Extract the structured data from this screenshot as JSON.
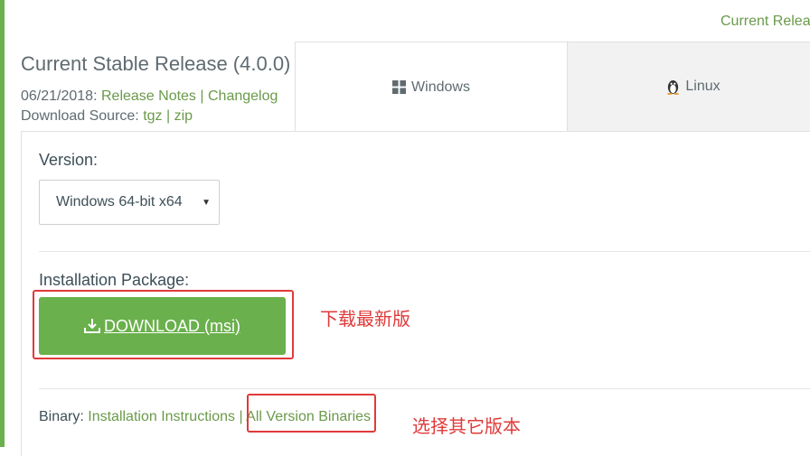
{
  "header": {
    "top_link": "Current Relea"
  },
  "release": {
    "title": "Current Stable Release (4.0.0)",
    "date": "06/21/2018:",
    "release_notes": "Release Notes",
    "separator": "|",
    "changelog": "Changelog",
    "download_source_label": "Download Source:",
    "tgz": "tgz",
    "zip": "zip"
  },
  "tabs": [
    {
      "label": "Windows",
      "icon": "windows-icon"
    },
    {
      "label": "Linux",
      "icon": "linux-penguin-icon"
    }
  ],
  "version": {
    "label": "Version:",
    "selected": "Windows 64-bit x64"
  },
  "package": {
    "label": "Installation Package:",
    "download_label": "DOWNLOAD (msi)"
  },
  "binary": {
    "label": "Binary:",
    "instructions": "Installation Instructions",
    "separator": "|",
    "all_versions": "All Version Binaries"
  },
  "annotations": {
    "download_note": "下载最新版",
    "versions_note": "选择其它版本",
    "color": "#e03a3a"
  },
  "colors": {
    "accent_green": "#6ab04c",
    "link_green": "#6a9a4a"
  }
}
